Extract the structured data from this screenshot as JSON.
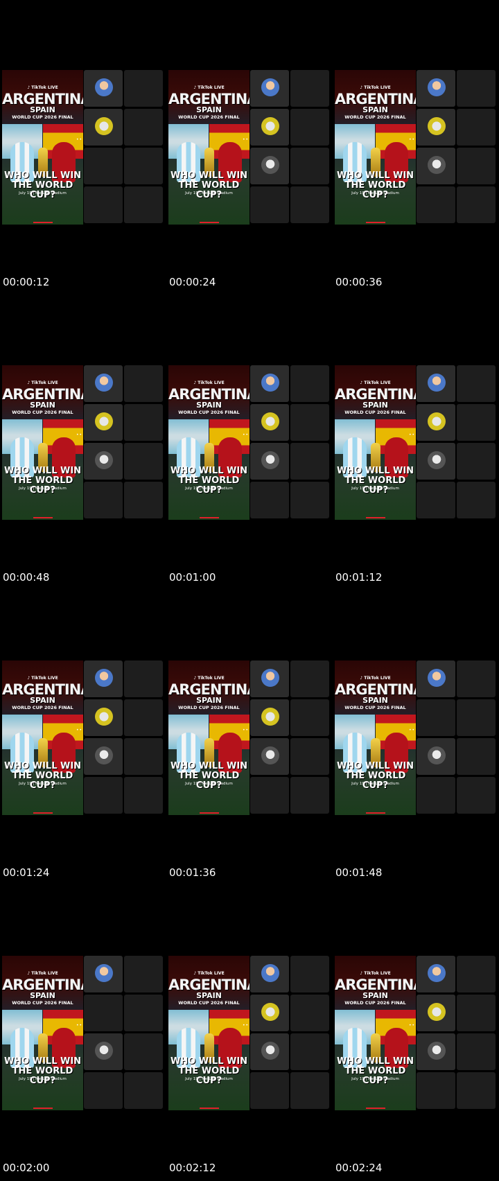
{
  "poster": {
    "tiktok": "♪ TikTok LIVE",
    "title_line1": "ARGENTINA",
    "title_line2": "SPAIN",
    "subtitle": "WORLD CUP 2026 FINAL",
    "question_line1": "WHO WILL WIN",
    "question_line2": "THE WORLD CUP?",
    "date_line": "July 19 | MetLife Stadium"
  },
  "frames": [
    {
      "timestamp": "00:00:12",
      "seats": [
        "blue",
        "yellow",
        "",
        ""
      ]
    },
    {
      "timestamp": "00:00:24",
      "seats": [
        "blue",
        "yellow",
        "grey",
        ""
      ]
    },
    {
      "timestamp": "00:00:36",
      "seats": [
        "blue",
        "yellow",
        "grey",
        ""
      ]
    },
    {
      "timestamp": "00:00:48",
      "seats": [
        "blue",
        "yellow",
        "grey",
        ""
      ]
    },
    {
      "timestamp": "00:01:00",
      "seats": [
        "blue",
        "yellow",
        "grey",
        ""
      ]
    },
    {
      "timestamp": "00:01:12",
      "seats": [
        "blue",
        "yellow",
        "grey",
        ""
      ]
    },
    {
      "timestamp": "00:01:24",
      "seats": [
        "blue",
        "yellow",
        "grey",
        ""
      ]
    },
    {
      "timestamp": "00:01:36",
      "seats": [
        "blue",
        "yellow",
        "grey",
        ""
      ]
    },
    {
      "timestamp": "00:01:48",
      "seats": [
        "blue",
        "",
        "grey",
        ""
      ]
    },
    {
      "timestamp": "00:02:00",
      "seats": [
        "blue",
        "",
        "grey",
        ""
      ]
    },
    {
      "timestamp": "00:02:12",
      "seats": [
        "blue",
        "yellow",
        "grey",
        ""
      ]
    },
    {
      "timestamp": "00:02:24",
      "seats": [
        "blue",
        "yellow",
        "grey",
        ""
      ]
    }
  ],
  "colors": {
    "background": "#000000",
    "seat": "#1e1e1e",
    "accent": "#e0202a"
  }
}
